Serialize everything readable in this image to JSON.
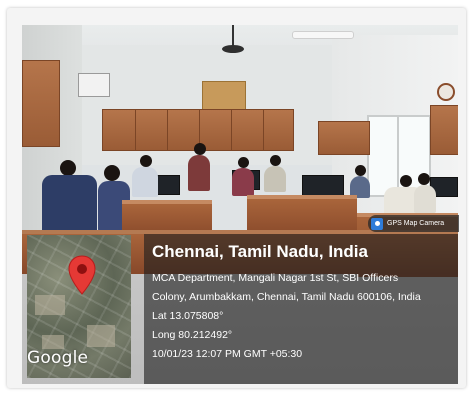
{
  "overlay": {
    "badge_label": "GPS Map Camera",
    "map_brand": "Google",
    "city": "Chennai, Tamil Nadu, India",
    "address_line1": "MCA Department, Mangali Nagar 1st St, SBI Officers",
    "address_line2": "Colony, Arumbakkam, Chennai, Tamil Nadu 600106, India",
    "latitude": "Lat 13.075808°",
    "longitude": "Long 80.212492°",
    "timestamp": "10/01/23 12:07 PM GMT +05:30"
  },
  "icons": {
    "badge": "camera-icon",
    "map_marker": "location-pin-icon"
  },
  "colors": {
    "overlay_background": "#1e1e1e",
    "pin": "#e53935",
    "text": "#ffffff",
    "cabinet": "#a9653b"
  }
}
